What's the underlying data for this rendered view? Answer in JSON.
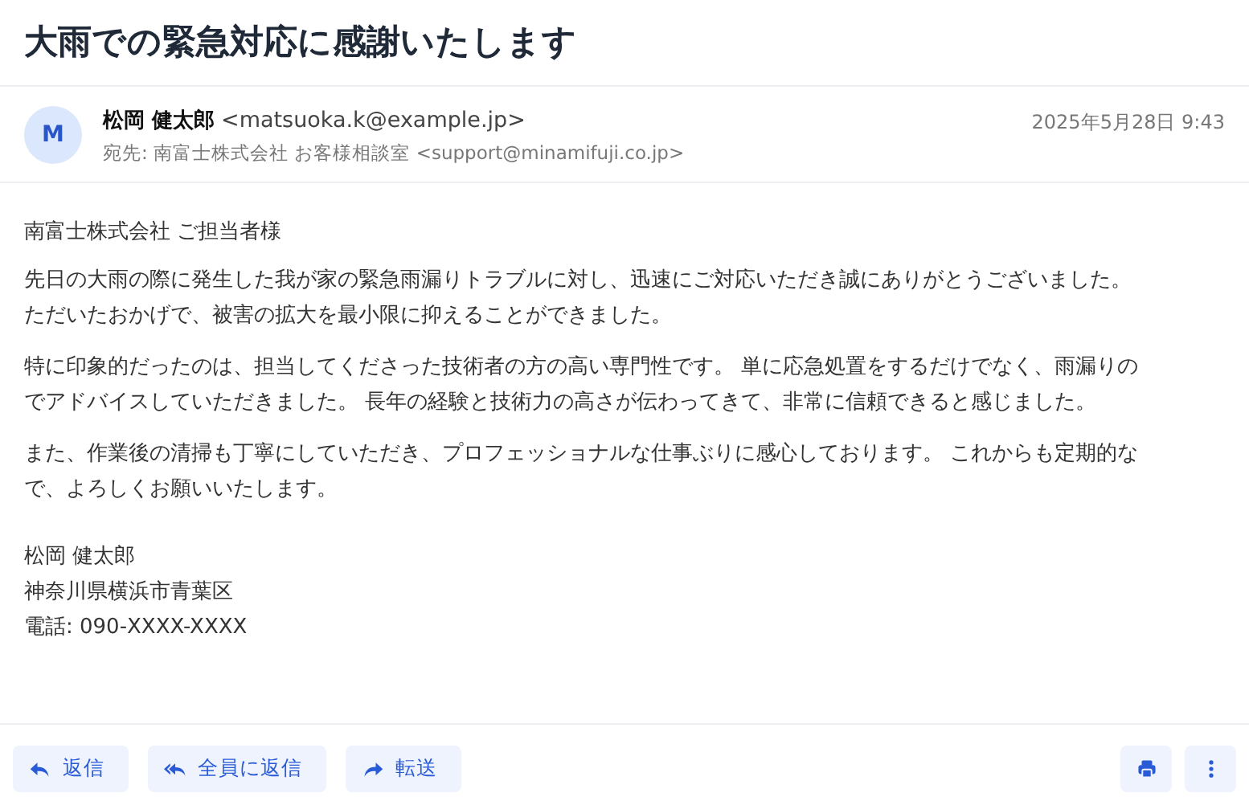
{
  "subject": "大雨での緊急対応に感謝いたします",
  "sender": {
    "avatar": "M",
    "name": "松岡 健太郎",
    "email": "<matsuoka.k@example.jp>",
    "to": "宛先: 南富士株式会社 お客様相談室 <support@minamifuji.co.jp>",
    "date": "2025年5月28日 9:43"
  },
  "greeting": "南富士株式会社 ご担当者様",
  "paragraphs": [
    {
      "lines": [
        "先日の大雨の際に発生した我が家の緊急雨漏りトラブルに対し、迅速にご対応いただき誠にありがとうございました。",
        "ただいたおかげで、被害の拡大を最小限に抑えることができました。"
      ]
    },
    {
      "lines": [
        "特に印象的だったのは、担当してくださった技術者の方の高い専門性です。 単に応急処置をするだけでなく、雨漏りの",
        "でアドバイスしていただきました。 長年の経験と技術力の高さが伝わってきて、非常に信頼できると感じました。"
      ]
    },
    {
      "lines": [
        "また、作業後の清掃も丁寧にしていただき、プロフェッショナルな仕事ぶりに感心しております。 これからも定期的な",
        "で、よろしくお願いいたします。"
      ]
    }
  ],
  "signature": [
    "松岡 健太郎",
    "神奈川県横浜市青葉区",
    "電話: 090-XXXX-XXXX"
  ],
  "actions": [
    {
      "kind": "reply",
      "label": "返信"
    },
    {
      "kind": "reply_all",
      "label": "全員に返信"
    },
    {
      "kind": "forward",
      "label": "転送"
    }
  ],
  "tools": [
    {
      "kind": "print"
    },
    {
      "kind": "more"
    }
  ]
}
